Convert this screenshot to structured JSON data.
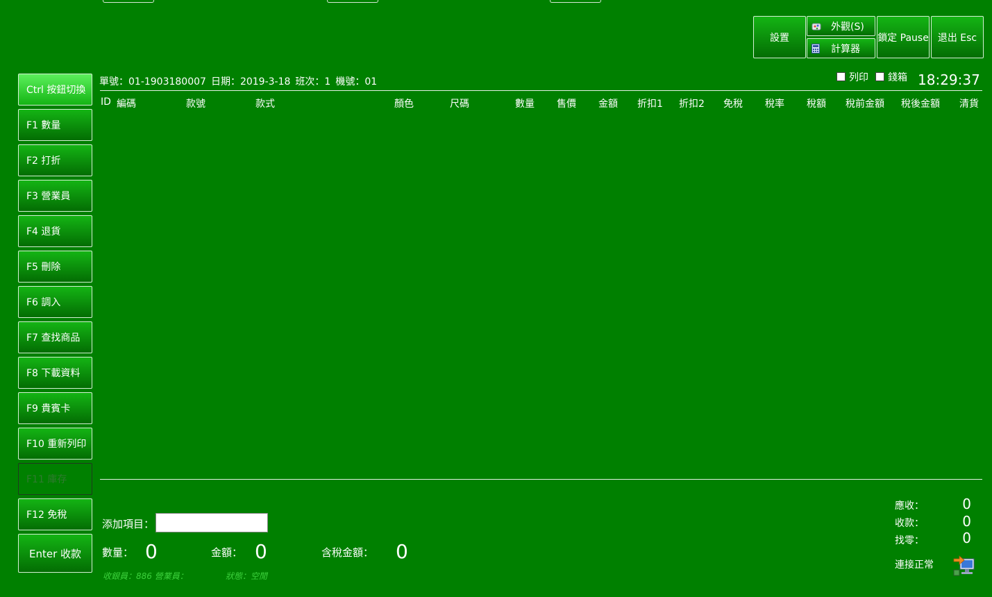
{
  "toolbar": {
    "settings": "設置",
    "appearance": "外觀(S)",
    "calculator": "計算器",
    "lock": "鎖定 Pause",
    "exit": "退出 Esc"
  },
  "info": {
    "order_no": "單號：01-1903180007",
    "date": "日期：2019-3-18",
    "shift": "班次：1",
    "machine": "機號：01"
  },
  "options": {
    "print": "列印",
    "cash_drawer": "錢箱"
  },
  "clock": "18:29:37",
  "columns": [
    "ID",
    "編碼",
    "款號",
    "款式",
    "顏色",
    "尺碼",
    "數量",
    "售價",
    "金額",
    "折扣1",
    "折扣2",
    "免稅",
    "稅率",
    "稅額",
    "稅前金額",
    "稅後金額",
    "清貨"
  ],
  "sidebar": {
    "items": [
      "Ctrl 按鈕切換",
      "F1 數量",
      "F2 打折",
      "F3 營業員",
      "F4 退貨",
      "F5 刪除",
      "F6 調入",
      "F7 查找商品",
      "F8 下載資料",
      "F9 貴賓卡",
      "F10 重新列印",
      "F11 庫存",
      "F12 免稅",
      "Enter 收款"
    ]
  },
  "add_item": {
    "label": "添加項目：",
    "value": ""
  },
  "totals": {
    "qty_label": "數量：",
    "qty": "0",
    "amount_label": "金額：",
    "amount": "0",
    "tax_amount_label": "含稅金額：",
    "tax_amount": "0"
  },
  "status": {
    "cashier": "收銀員：886 營業員：",
    "state": "狀態：空閒"
  },
  "summary": {
    "receivable_label": "應收：",
    "receivable": "0",
    "received_label": "收款：",
    "received": "0",
    "change_label": "找零：",
    "change": "0",
    "connection": "連接正常"
  },
  "colors": {
    "background": "#008000",
    "button_top": "#14b414",
    "button_bottom": "#036d03",
    "status_text": "#3cd03c"
  },
  "icons": [
    "appearance-icon",
    "calculator-icon",
    "network-connection-icon"
  ]
}
